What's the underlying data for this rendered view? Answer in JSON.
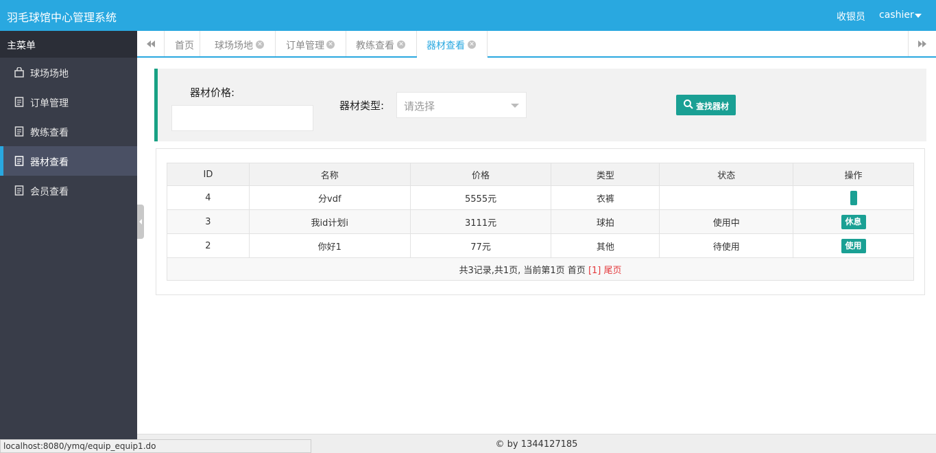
{
  "header": {
    "app_title": "羽毛球馆中心管理系统",
    "role": "收银员",
    "user": "cashier"
  },
  "sidebar": {
    "title": "主菜单",
    "items": [
      {
        "label": "球场场地",
        "icon": "bag-icon"
      },
      {
        "label": "订单管理",
        "icon": "document-icon"
      },
      {
        "label": "教练查看",
        "icon": "document-icon"
      },
      {
        "label": "器材查看",
        "icon": "document-icon",
        "active": true
      },
      {
        "label": "会员查看",
        "icon": "document-icon"
      }
    ]
  },
  "tabs": [
    {
      "label": "首页"
    },
    {
      "label": "球场场地"
    },
    {
      "label": "订单管理"
    },
    {
      "label": "教练查看"
    },
    {
      "label": "器材查看",
      "active": true
    }
  ],
  "filter": {
    "price_label": "器材价格:",
    "price_value": "",
    "type_label": "器材类型:",
    "type_placeholder": "请选择",
    "search_label": "查找器材"
  },
  "table": {
    "headers": [
      "ID",
      "名称",
      "价格",
      "类型",
      "状态",
      "操作"
    ],
    "rows": [
      {
        "id": "4",
        "name": "分vdf",
        "price": "5555元",
        "type": "衣裤",
        "status": "",
        "action": ""
      },
      {
        "id": "3",
        "name": "我id计划i",
        "price": "3111元",
        "type": "球拍",
        "status": "使用中",
        "action": "休息"
      },
      {
        "id": "2",
        "name": "你好1",
        "price": "77元",
        "type": "其他",
        "status": "待使用",
        "action": "使用"
      }
    ],
    "pager": {
      "summary": "共3记录,共1页, 当前第1页 首页",
      "current": "[1]",
      "last": "尾页"
    }
  },
  "footer": {
    "copyright": "© by 1344127185"
  },
  "statusbar": {
    "url": "localhost:8080/ymq/equip_equip1.do"
  },
  "colors": {
    "topbar": "#29a8e0",
    "sidebar": "#393d49",
    "accent_green": "#1aa094",
    "pager_red": "#e4393c"
  }
}
